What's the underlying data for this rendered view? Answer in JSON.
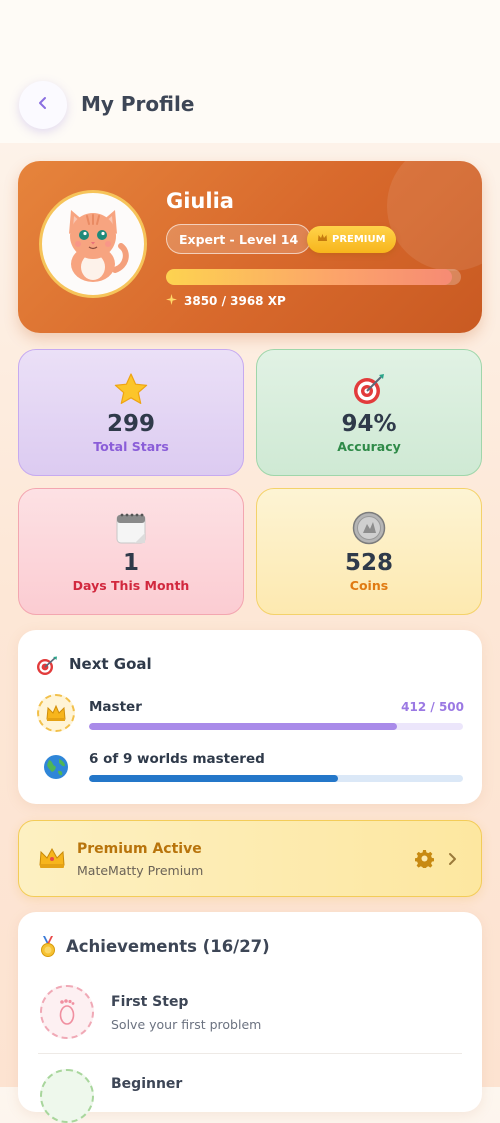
{
  "header": {
    "title": "My Profile"
  },
  "profile": {
    "name": "Giulia",
    "level_label": "Expert - Level 14",
    "premium_badge": "PREMIUM",
    "xp_text": "3850 / 3968 XP",
    "xp_progress": 0.9703
  },
  "stats": [
    {
      "value": "299",
      "label": "Total Stars",
      "icon": "star-icon"
    },
    {
      "value": "94%",
      "label": "Accuracy",
      "icon": "target-icon"
    },
    {
      "value": "1",
      "label": "Days This Month",
      "icon": "calendar-icon"
    },
    {
      "value": "528",
      "label": "Coins",
      "icon": "coin-icon"
    }
  ],
  "next_goal": {
    "title": "Next Goal",
    "rows": [
      {
        "label": "Master",
        "count": "412 / 500",
        "progress": 0.824,
        "icon": "crown-icon",
        "color": "#a98be9"
      },
      {
        "label": "6 of 9 worlds mastered",
        "count": "",
        "progress": 0.667,
        "icon": "globe-icon",
        "color": "#2477c9"
      }
    ]
  },
  "premium": {
    "title": "Premium Active",
    "subtitle": "MateMatty Premium"
  },
  "achievements": {
    "title": "Achievements (16/27)",
    "items": [
      {
        "title": "First Step",
        "subtitle": "Solve your first problem",
        "icon": "footprint-icon"
      },
      {
        "title": "Beginner",
        "subtitle": "",
        "icon": "badge-icon"
      }
    ]
  },
  "colors": {
    "accent": "#e07a35",
    "premium": "#f7b51c"
  }
}
